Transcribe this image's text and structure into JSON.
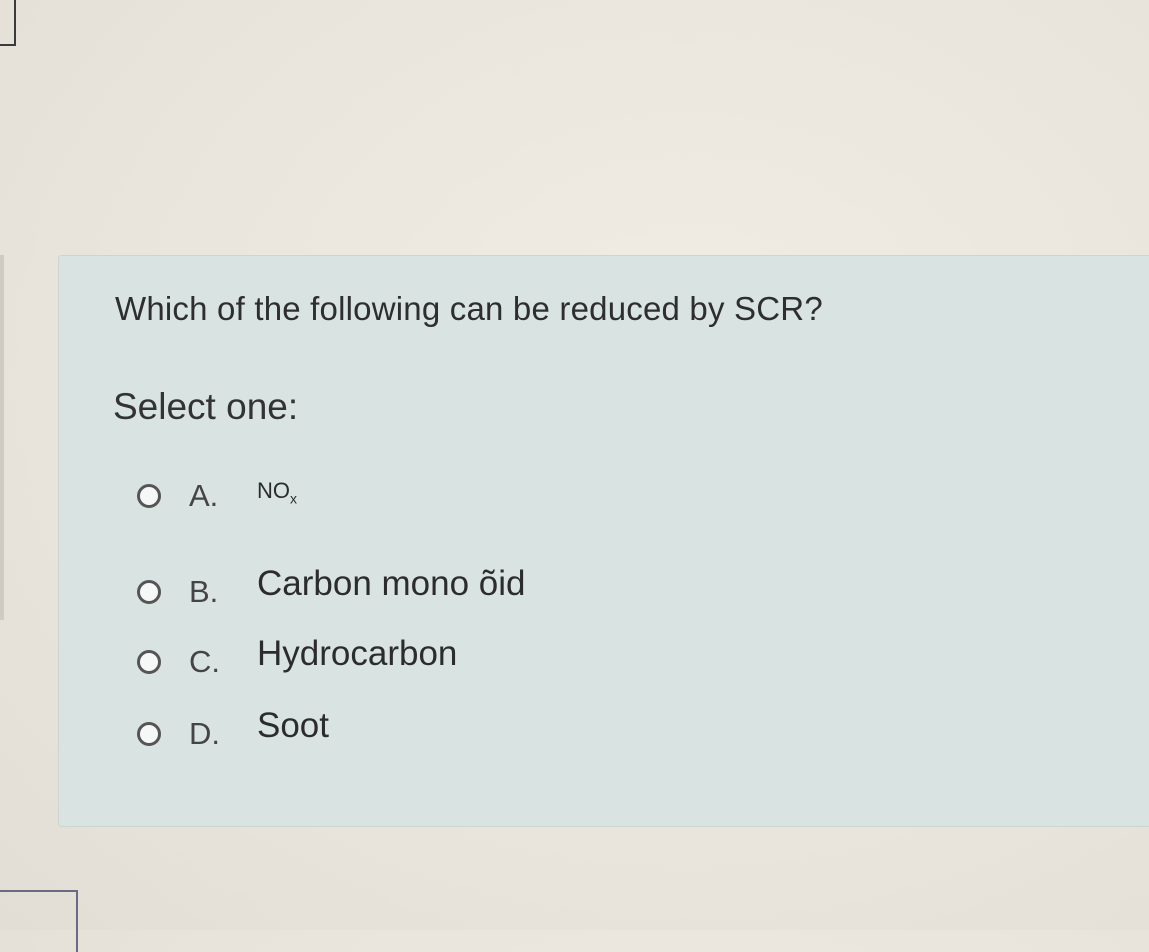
{
  "question": {
    "text": "Which of the following can be reduced by SCR?",
    "prompt": "Select one:",
    "options": [
      {
        "letter": "A.",
        "text": "NO",
        "subscript": "x"
      },
      {
        "letter": "B.",
        "text": "Carbon mono õid"
      },
      {
        "letter": "C.",
        "text": "Hydrocarbon"
      },
      {
        "letter": "D.",
        "text": "Soot"
      }
    ]
  },
  "colors": {
    "background": "#ece8e0",
    "card": "#d9e4e2",
    "text": "#2e2e2e"
  }
}
